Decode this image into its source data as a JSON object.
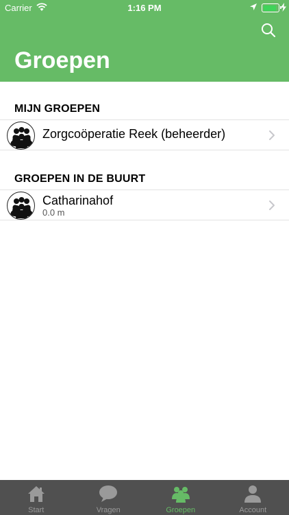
{
  "status_bar": {
    "carrier": "Carrier",
    "time": "1:16 PM",
    "battery_level": 0.9
  },
  "header": {
    "title": "Groepen",
    "search_icon": "search-icon",
    "background_color": "#66bb66"
  },
  "sections": [
    {
      "title": "MIJN GROEPEN",
      "rows": [
        {
          "name": "Zorgcoöperatie Reek (beheerder)",
          "subtitle": "",
          "icon": "group-avatar-icon"
        }
      ]
    },
    {
      "title": "GROEPEN IN DE BUURT",
      "rows": [
        {
          "name": "Catharinahof",
          "subtitle": "0.0 m",
          "icon": "group-avatar-icon"
        }
      ]
    }
  ],
  "tab_bar": {
    "active_color": "#66bb66",
    "inactive_color": "#9a9a9a",
    "tabs": [
      {
        "label": "Start",
        "icon": "home-icon",
        "active": false
      },
      {
        "label": "Vragen",
        "icon": "chat-bubble-icon",
        "active": false
      },
      {
        "label": "Groepen",
        "icon": "groups-icon",
        "active": true
      },
      {
        "label": "Account",
        "icon": "person-icon",
        "active": false
      }
    ]
  }
}
